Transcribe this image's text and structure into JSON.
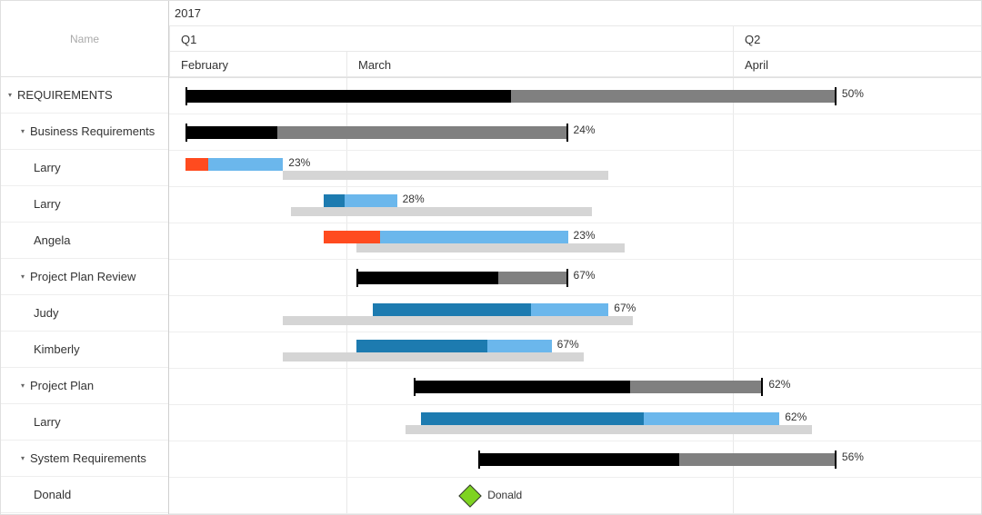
{
  "chart_data": {
    "type": "gantt",
    "title": "",
    "timeline": {
      "year": "2017",
      "quarters": [
        "Q1",
        "Q2"
      ],
      "months": [
        "February",
        "March",
        "April"
      ]
    },
    "rows": [
      {
        "id": "req",
        "name": "REQUIREMENTS",
        "level": 0,
        "type": "summary",
        "start": 2,
        "end": 82,
        "progress": 50
      },
      {
        "id": "biz",
        "name": "Business Requirements",
        "level": 1,
        "type": "summary",
        "start": 2,
        "end": 49,
        "progress": 24
      },
      {
        "id": "larry1",
        "name": "Larry",
        "level": 2,
        "type": "task",
        "start": 2,
        "end": 14,
        "baseline_start": 14,
        "baseline_end": 54,
        "progress": 23,
        "behind": true
      },
      {
        "id": "larry2",
        "name": "Larry",
        "level": 2,
        "type": "task",
        "start": 19,
        "end": 28,
        "baseline_start": 15,
        "baseline_end": 52,
        "progress": 28
      },
      {
        "id": "angela",
        "name": "Angela",
        "level": 2,
        "type": "task",
        "start": 19,
        "end": 49,
        "baseline_start": 23,
        "baseline_end": 56,
        "progress": 23,
        "behind": true
      },
      {
        "id": "ppr",
        "name": "Project Plan Review",
        "level": 1,
        "type": "summary",
        "start": 23,
        "end": 49,
        "progress": 67
      },
      {
        "id": "judy",
        "name": "Judy",
        "level": 2,
        "type": "task",
        "start": 25,
        "end": 54,
        "baseline_start": 14,
        "baseline_end": 57,
        "progress": 67
      },
      {
        "id": "kim",
        "name": "Kimberly",
        "level": 2,
        "type": "task",
        "start": 23,
        "end": 47,
        "baseline_start": 14,
        "baseline_end": 51,
        "progress": 67
      },
      {
        "id": "pp",
        "name": "Project Plan",
        "level": 1,
        "type": "summary",
        "start": 30,
        "end": 73,
        "progress": 62
      },
      {
        "id": "larry3",
        "name": "Larry",
        "level": 2,
        "type": "task",
        "start": 31,
        "end": 75,
        "baseline_start": 29,
        "baseline_end": 79,
        "progress": 62
      },
      {
        "id": "sys",
        "name": "System Requirements",
        "level": 1,
        "type": "summary",
        "start": 38,
        "end": 82,
        "progress": 56
      },
      {
        "id": "donald",
        "name": "Donald",
        "level": 2,
        "type": "milestone",
        "start": 36,
        "label": "Donald"
      }
    ]
  },
  "left_header": "Name",
  "colors": {
    "summary_bg": "#808080",
    "summary_fg": "#000000",
    "task_bg": "#6bb7ec",
    "task_fg": "#1d7bb0",
    "task_behind": "#ff4b1f",
    "baseline": "#d5d5d5",
    "milestone": "#7ed321"
  }
}
